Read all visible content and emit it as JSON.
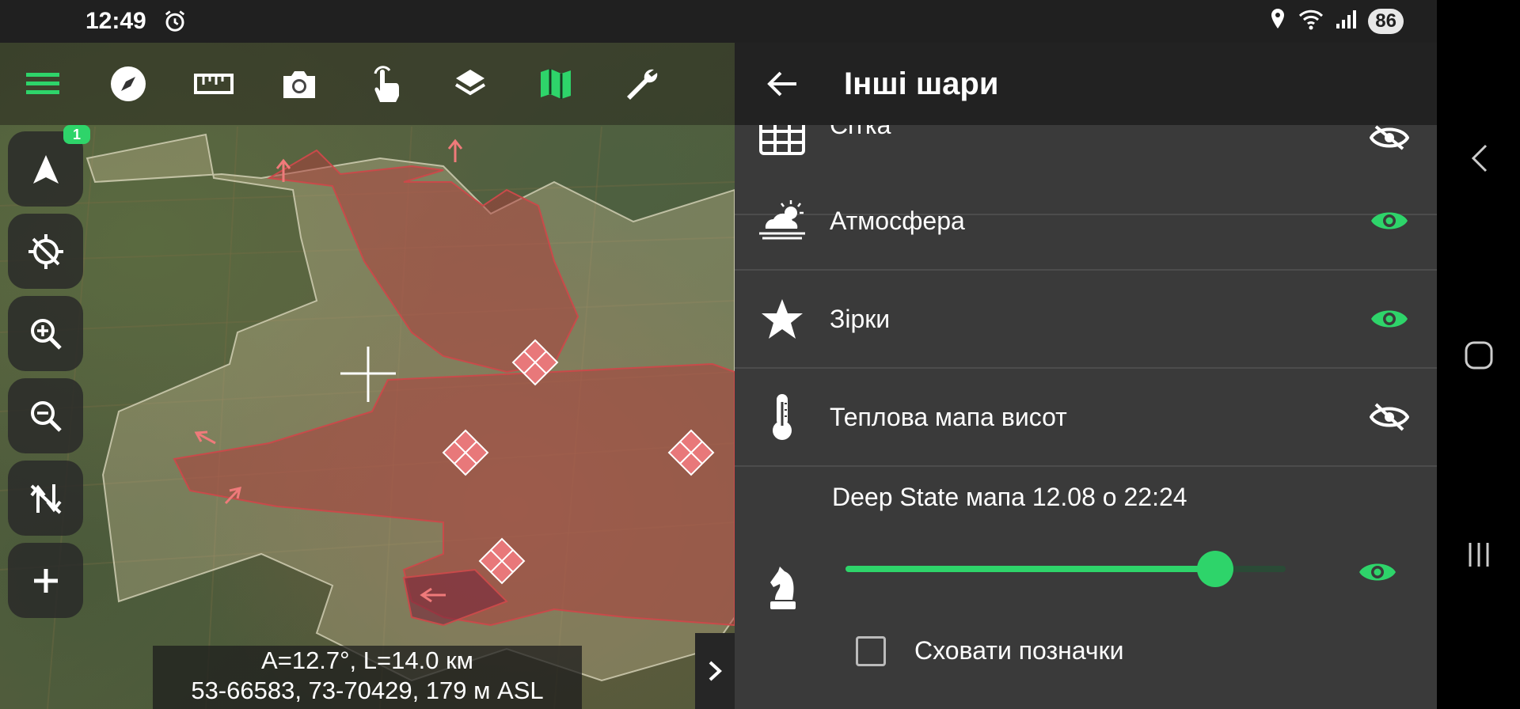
{
  "status": {
    "time": "12:49",
    "battery": "86"
  },
  "toolbar": {
    "items": [
      "menu-icon",
      "compass-icon",
      "ruler-icon",
      "camera-icon",
      "touch-icon",
      "layers-icon",
      "map-icon",
      "wrench-icon"
    ],
    "accent": "#2ed46a"
  },
  "side_controls": {
    "nav_badge": "1",
    "items": [
      "navigation-arrow-icon",
      "gps-off-icon",
      "zoom-in-icon",
      "zoom-out-icon",
      "sync-off-icon",
      "add-icon"
    ]
  },
  "info": {
    "line1": "A=12.7°, L=14.0 км",
    "line2": "53-66583, 73-70429, 179 м ASL"
  },
  "panel": {
    "title": "Інші шари",
    "rows": [
      {
        "label": "Сітка",
        "icon": "grid-icon",
        "visible": false
      },
      {
        "label": "Атмосфера",
        "icon": "weather-icon",
        "visible": true
      },
      {
        "label": "Зірки",
        "icon": "star-icon",
        "visible": true
      },
      {
        "label": "Теплова мапа висот",
        "icon": "thermometer-icon",
        "visible": false
      }
    ],
    "deep_state": {
      "title": "Deep State мапа 12.08 о 22:24",
      "opacity": 0.84,
      "visible": true,
      "hide_marks_label": "Сховати позначки",
      "hide_marks_checked": false
    }
  },
  "colors": {
    "accent": "#2ed46a",
    "panel_bg": "#3a3a3a",
    "header_bg": "#222222",
    "occupied_zone": "#b03a3a"
  }
}
